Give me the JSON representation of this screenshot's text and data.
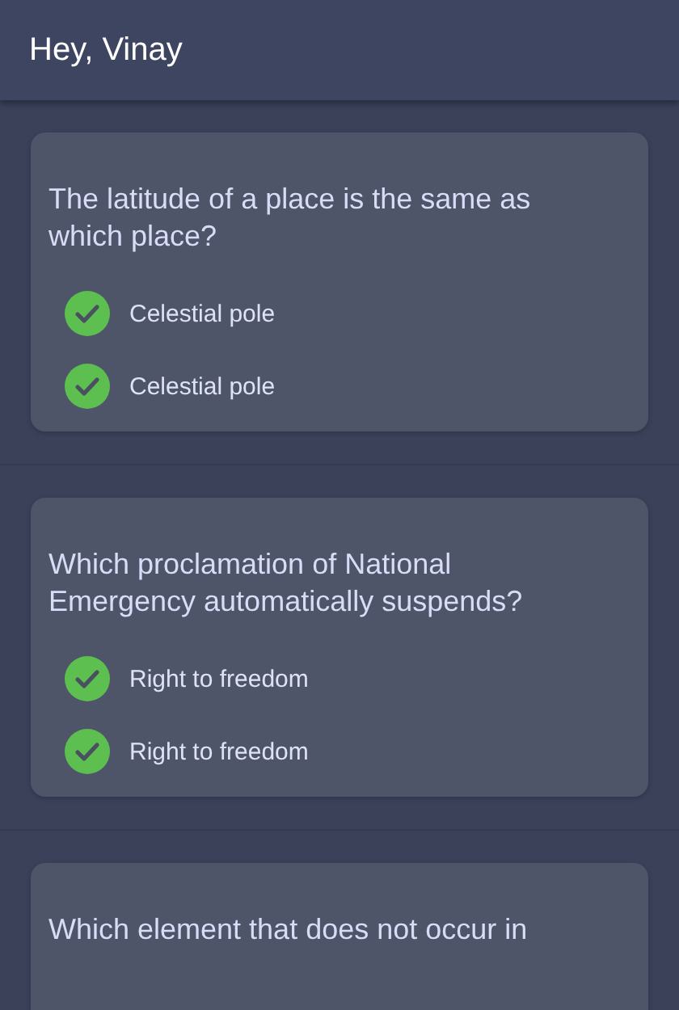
{
  "app_bar": {
    "title": "Hey, Vinay"
  },
  "questions": [
    {
      "question": "The latitude of a place is the same as which place?",
      "options": [
        {
          "label": "Celestial pole",
          "checked": true
        },
        {
          "label": "Celestial pole",
          "checked": true
        }
      ]
    },
    {
      "question": "Which proclamation of National Emergency automatically suspends?",
      "options": [
        {
          "label": "Right to freedom",
          "checked": true
        },
        {
          "label": "Right to freedom",
          "checked": true
        }
      ]
    },
    {
      "question": "Which element that does not occur in"
    }
  ]
}
